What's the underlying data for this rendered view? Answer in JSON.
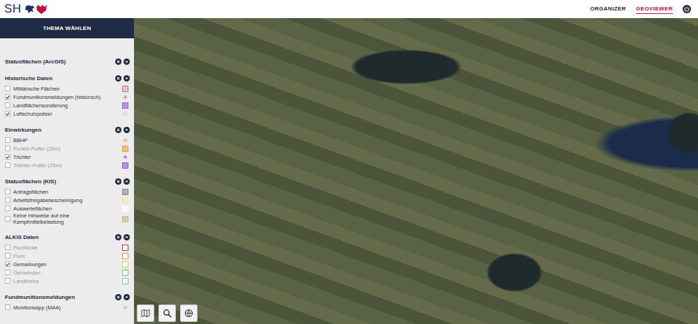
{
  "header": {
    "logo": "SH",
    "nav": [
      {
        "label": "ORGANIZER",
        "selected": false
      },
      {
        "label": "GEOVIEWER",
        "selected": true
      }
    ]
  },
  "sidebar": {
    "title": "THEMA WÄHLEN",
    "groups": [
      {
        "title": "Statusflächen (ArcGIS)",
        "expanded": false,
        "items": []
      },
      {
        "title": "Historische Daten",
        "expanded": true,
        "items": [
          {
            "label": "Militärische Flächen",
            "checked": false,
            "disabled": false,
            "legend": {
              "kind": "hatched",
              "color": "#e0668a"
            }
          },
          {
            "label": "Fundmunitionsmeldungen (historisch)",
            "checked": true,
            "disabled": false,
            "legend": {
              "kind": "dot",
              "color": "#e0507a"
            }
          },
          {
            "label": "Landflächensondierung",
            "checked": false,
            "disabled": false,
            "legend": {
              "kind": "square",
              "color": "#9a5fd0"
            }
          },
          {
            "label": "Luftschutzpolizei",
            "checked": true,
            "disabled": false,
            "legend": {
              "kind": "dot",
              "color": "#9ee0e6"
            }
          }
        ]
      },
      {
        "title": "Einwirkungen",
        "expanded": true,
        "items": [
          {
            "label": "BBHP",
            "checked": false,
            "disabled": false,
            "legend": {
              "kind": "dot",
              "color": "#f0a040"
            }
          },
          {
            "label": "Punkte-Puffer (25m)",
            "checked": false,
            "disabled": true,
            "legend": {
              "kind": "square",
              "color": "#f0a050"
            }
          },
          {
            "label": "Trichter",
            "checked": true,
            "disabled": false,
            "legend": {
              "kind": "dot",
              "color": "#7050c0"
            }
          },
          {
            "label": "Trichter-Puffer (25m)",
            "checked": false,
            "disabled": true,
            "legend": {
              "kind": "square",
              "color": "#8a5fd0"
            }
          }
        ]
      },
      {
        "title": "Statusflächen (KIS)",
        "expanded": true,
        "items": [
          {
            "label": "Antragsflächen",
            "checked": false,
            "disabled": false,
            "legend": {
              "kind": "square",
              "color": "#8a8a8a"
            }
          },
          {
            "label": "Arbeitsfreigabebescheinigung",
            "checked": false,
            "disabled": false,
            "legend": {
              "kind": "square",
              "color": "#f7e2b5"
            }
          },
          {
            "label": "Auswerteflächen",
            "checked": false,
            "disabled": false,
            "legend": {
              "kind": "square",
              "color": "#ffffff"
            }
          },
          {
            "label": "Keine Hinweise auf eine Kampfmittelbelastung",
            "checked": false,
            "disabled": false,
            "legend": {
              "kind": "square",
              "color": "#c8b58a"
            }
          }
        ]
      },
      {
        "title": "ALKIS Daten",
        "expanded": true,
        "items": [
          {
            "label": "Flurstücke",
            "checked": false,
            "disabled": true,
            "legend": {
              "kind": "outline",
              "color": "#c0304a"
            }
          },
          {
            "label": "Flure",
            "checked": false,
            "disabled": true,
            "legend": {
              "kind": "outline",
              "color": "#e0a050"
            }
          },
          {
            "label": "Gemarkungen",
            "checked": true,
            "disabled": false,
            "legend": {
              "kind": "outline",
              "color": "#e8c850"
            }
          },
          {
            "label": "Gemeinden",
            "checked": false,
            "disabled": true,
            "legend": {
              "kind": "outline",
              "color": "#70c0a0"
            }
          },
          {
            "label": "Landkreise",
            "checked": false,
            "disabled": true,
            "legend": {
              "kind": "outline",
              "color": "#a0a8e8"
            }
          }
        ]
      },
      {
        "title": "Fundmunitionsmeldungen",
        "expanded": true,
        "items": [
          {
            "label": "Munitionsapp (MAA)",
            "checked": false,
            "disabled": false,
            "legend": {
              "kind": "dot",
              "color": "#f0b040"
            }
          }
        ]
      }
    ]
  }
}
